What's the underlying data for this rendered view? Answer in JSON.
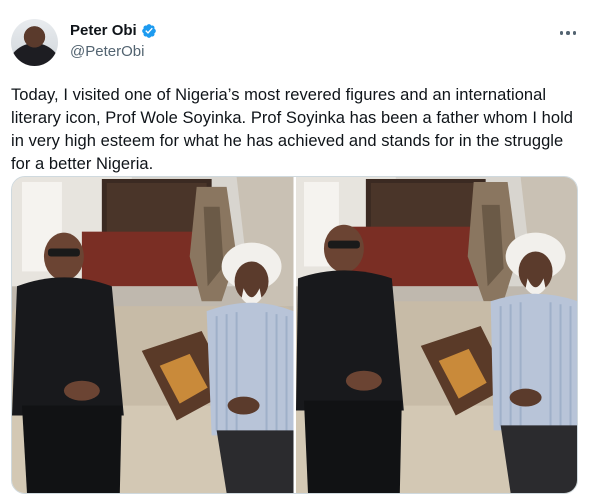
{
  "author": {
    "name": "Peter Obi",
    "handle": "@PeterObi",
    "verified": true
  },
  "tweet": {
    "text": "Today, I visited one of Nigeria’s most revered figures and an international literary icon, Prof Wole Soyinka. Prof Soyinka has been a father whom I hold in very high esteem for what he has achieved and stands for in the struggle for a better Nigeria."
  },
  "media": {
    "photos": [
      "photo-left",
      "photo-right"
    ]
  },
  "icons": {
    "verified": "verified-badge-icon",
    "more": "more-options-icon"
  },
  "colors": {
    "verified_blue": "#1d9bf0",
    "secondary_text": "#536471",
    "primary_text": "#0f1419"
  }
}
